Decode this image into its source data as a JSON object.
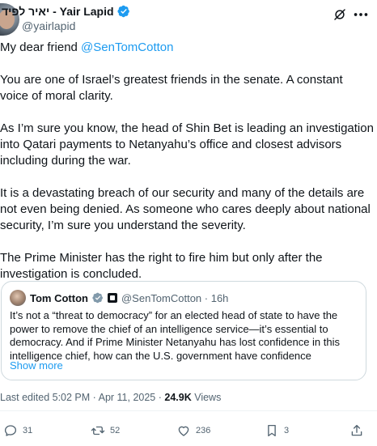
{
  "author": {
    "display_name": "יאיר לפיד - Yair Lapid",
    "handle": "@yairlapid",
    "verified_color": "#1d9bf0"
  },
  "tweet": {
    "greeting_prefix": "My dear friend ",
    "greeting_mention": "@SenTomCotton",
    "paragraphs": [
      "You are one of Israel’s greatest friends in the senate. A constant voice of moral clarity.",
      "As I’m sure you know, the head of Shin Bet is leading an investigation into Qatari payments to Netanyahu’s office and closest advisors including during the war.",
      "It is a devastating breach of our security and many of the details are not even being denied. As someone who cares deeply about national security, I’m sure you understand the severity.",
      "The Prime Minister has the right to fire him but only after the investigation is concluded."
    ]
  },
  "quote": {
    "name": "Tom Cotton",
    "handle_time": "@SenTomCotton · 16h",
    "text": "It’s not a “threat to democracy” for an elected head of state to have the power to remove the chief of an intelligence service—it’s essential to democracy. And if Prime Minister Netanyahu has lost confidence in this intelligence chief, how can the U.S. government have confidence",
    "show_more": "Show more"
  },
  "meta": {
    "edited": "Last edited 5:02 PM · Apr 11, 2025 · ",
    "views_count": "24.9K",
    "views_label": " Views"
  },
  "actions": {
    "replies": "31",
    "reposts": "52",
    "likes": "236",
    "bookmarks": "3"
  },
  "icons": {
    "verified": "verified-badge-icon",
    "grok": "grok-icon",
    "more": "more-icon",
    "reply": "reply-icon",
    "repost": "repost-icon",
    "like": "like-icon",
    "bookmark": "bookmark-icon",
    "share": "share-icon"
  },
  "colors": {
    "accent": "#1d9bf0",
    "text": "#0f1419",
    "secondary": "#536471",
    "border": "#cfd9de"
  }
}
